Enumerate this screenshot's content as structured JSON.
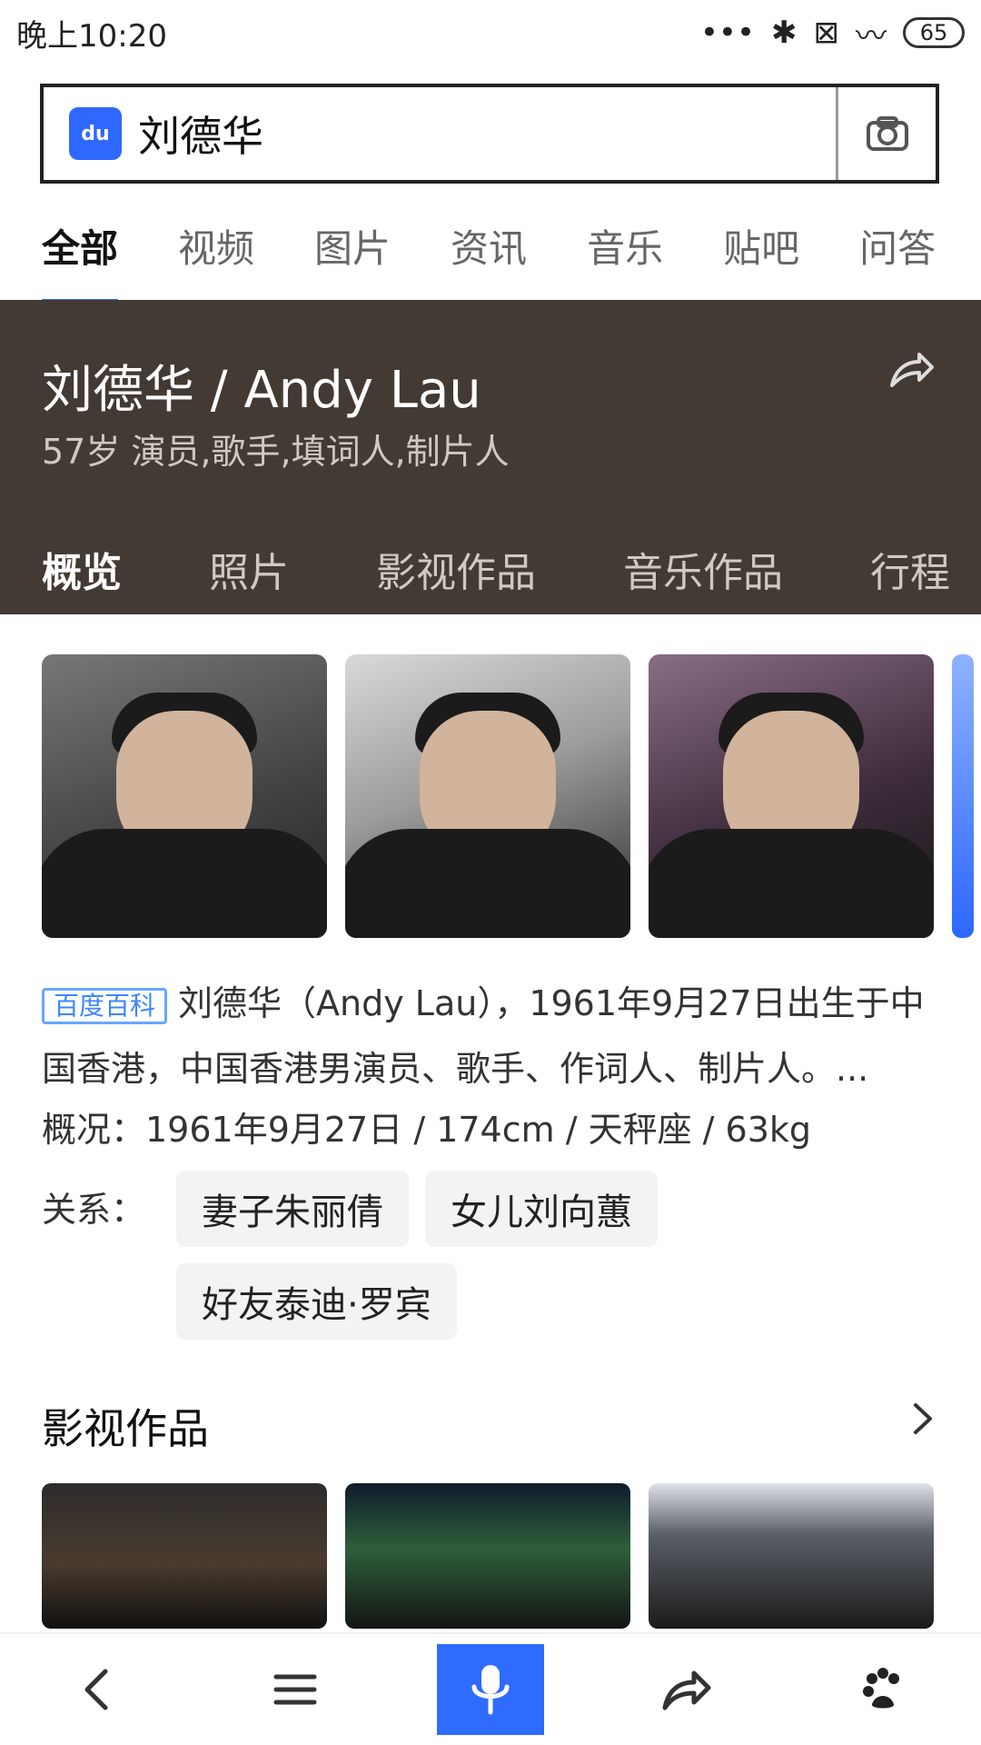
{
  "status_bar": {
    "time": "晚上10:20",
    "battery": "65"
  },
  "search": {
    "query": "刘德华"
  },
  "tabs": [
    "全部",
    "视频",
    "图片",
    "资讯",
    "音乐",
    "贴吧",
    "问答"
  ],
  "card": {
    "title": "刘德华 / Andy Lau",
    "subtitle": "57岁 演员,歌手,填词人,制片人",
    "tabs": [
      "概览",
      "照片",
      "影视作品",
      "音乐作品",
      "行程"
    ]
  },
  "summary": {
    "badge": "百度百科",
    "text": "刘德华（Andy Lau），1961年9月27日出生于中国香港，中国香港男演员、歌手、作词人、制片人。..."
  },
  "facts": {
    "text": "概况：1961年9月27日  /  174cm  /  天秤座  /  63kg"
  },
  "relations": {
    "label": "关系：",
    "items": [
      "妻子朱丽倩",
      "女儿刘向蕙",
      "好友泰迪·罗宾"
    ]
  },
  "section": {
    "title": "影视作品"
  }
}
